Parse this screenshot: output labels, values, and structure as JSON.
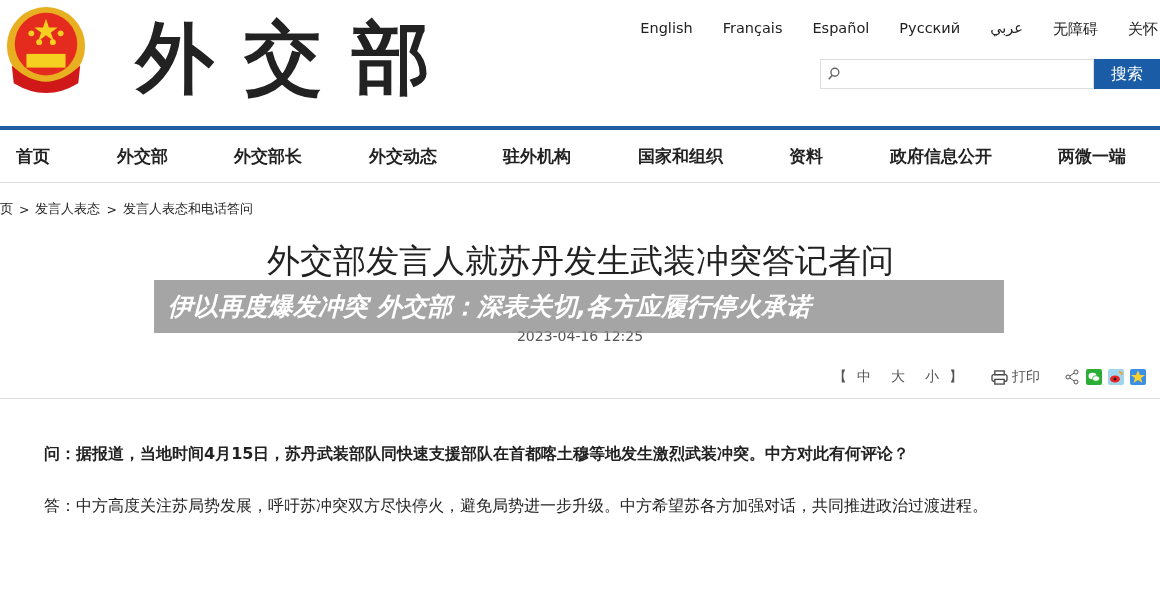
{
  "header": {
    "logo_text": "外交部",
    "languages": [
      "English",
      "Français",
      "Español",
      "Русский",
      "عربي",
      "无障碍",
      "关怀"
    ],
    "search": {
      "button": "搜索"
    }
  },
  "nav": [
    "首页",
    "外交部",
    "外交部长",
    "外交动态",
    "驻外机构",
    "国家和组织",
    "资料",
    "政府信息公开",
    "两微一端"
  ],
  "breadcrumb": [
    "页",
    "发言人表态",
    "发言人表态和电话答问"
  ],
  "breadcrumb_separator": ">",
  "article": {
    "title": "外交部发言人就苏丹发生武装冲突答记者问",
    "date": "2023-04-16 12:25",
    "font_sizes": {
      "open": "【",
      "sizes": [
        "中",
        "大",
        "小"
      ],
      "close": "】"
    },
    "print": "打印",
    "paragraphs": [
      {
        "kind": "question",
        "text": "问：据报道，当地时间4月15日，苏丹武装部队同快速支援部队在首都喀土穆等地发生激烈武装冲突。中方对此有何评论？"
      },
      {
        "kind": "answer",
        "text": "答：中方高度关注苏局势发展，呼吁苏冲突双方尽快停火，避免局势进一步升级。中方希望苏各方加强对话，共同推进政治过渡进程。"
      }
    ]
  },
  "overlay_caption": "伊以再度爆发冲突 外交部：深表关切,各方应履行停火承诺"
}
